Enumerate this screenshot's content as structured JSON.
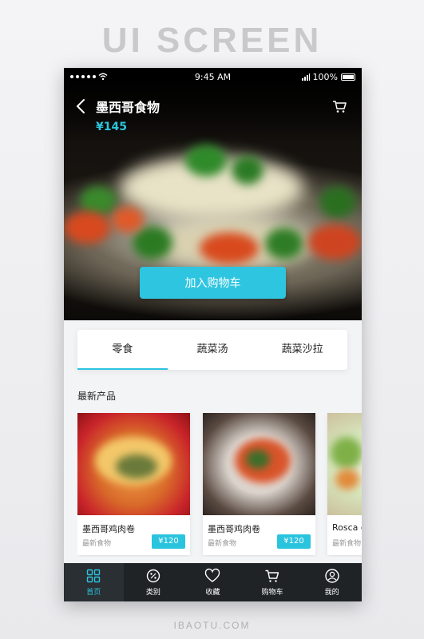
{
  "banner": "UI SCREEN",
  "footer_mark": "IBAOTU.COM",
  "status_bar": {
    "time": "9:45 AM",
    "battery": "100%"
  },
  "header": {
    "title": "墨西哥食物",
    "price": "¥145"
  },
  "hero": {
    "add_to_cart": "加入购物车"
  },
  "tabs": [
    {
      "label": "零食",
      "active": true
    },
    {
      "label": "蔬菜汤",
      "active": false
    },
    {
      "label": "蔬菜沙拉",
      "active": false
    }
  ],
  "section_title": "最新产品",
  "products": [
    {
      "name": "墨西哥鸡肉卷",
      "subtitle": "最新食物",
      "price": "¥120"
    },
    {
      "name": "墨西哥鸡肉卷",
      "subtitle": "最新食物",
      "price": "¥120"
    },
    {
      "name": "Rosca de",
      "subtitle": "最新食物",
      "price": ""
    }
  ],
  "nav": [
    {
      "label": "首页",
      "icon": "home-grid-icon",
      "active": true
    },
    {
      "label": "类别",
      "icon": "category-icon",
      "active": false
    },
    {
      "label": "收藏",
      "icon": "heart-icon",
      "active": false
    },
    {
      "label": "购物车",
      "icon": "cart-icon",
      "active": false
    },
    {
      "label": "我的",
      "icon": "user-icon",
      "active": false
    }
  ],
  "colors": {
    "accent": "#2bc4de",
    "nav_bg": "#1f2326",
    "page_bg": "#f3f4f6"
  }
}
